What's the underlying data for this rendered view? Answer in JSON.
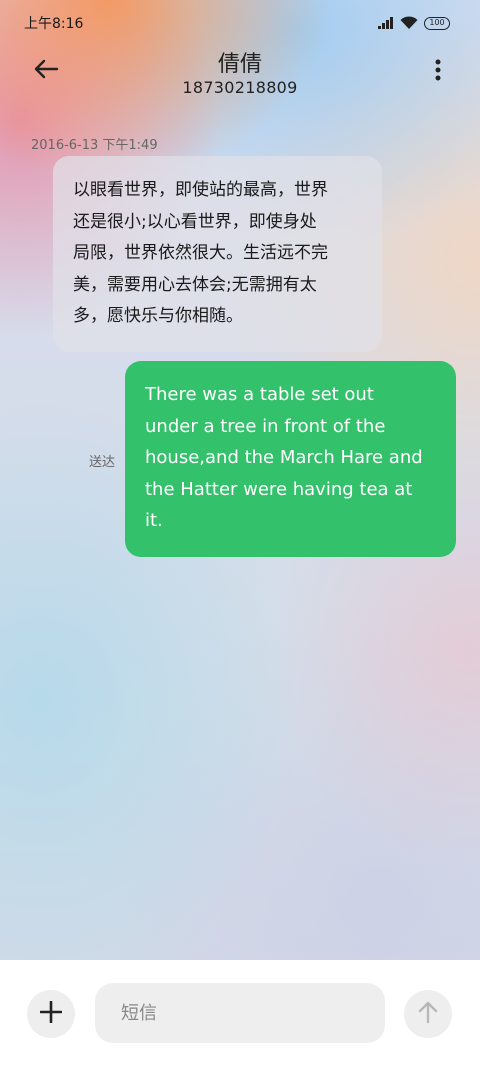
{
  "status_bar": {
    "time": "上午8:16",
    "battery": "100",
    "icons": [
      "signal-icon",
      "wifi-icon",
      "battery-icon"
    ]
  },
  "header": {
    "back_icon": "back-arrow-icon",
    "contact_name": "倩倩",
    "contact_number": "18730218809",
    "more_icon": "more-vertical-icon"
  },
  "conversation": {
    "timestamp": "2016-6-13 下午1:49",
    "incoming": {
      "lines": [
        "以眼看世界，即使站的最高，世界",
        "还是很小;以心看世界，即使身处",
        "局限，世界依然很大。生活远不完",
        "美，需要用心去体会;无需拥有太",
        "多，愿快乐与你相随。"
      ]
    },
    "outgoing": {
      "lines": [
        "There was a table set out",
        "under a tree in front of the",
        "house,and the March Hare and",
        "the Hatter were having tea at",
        "it."
      ],
      "status": "送达"
    }
  },
  "composer": {
    "add_icon": "plus-icon",
    "placeholder": "短信",
    "value": "",
    "send_icon": "arrow-up-icon"
  },
  "colors": {
    "outgoing_bubble": "#34c16b",
    "incoming_bubble": "#e1e1e8",
    "composer_background": "#ffffff"
  }
}
